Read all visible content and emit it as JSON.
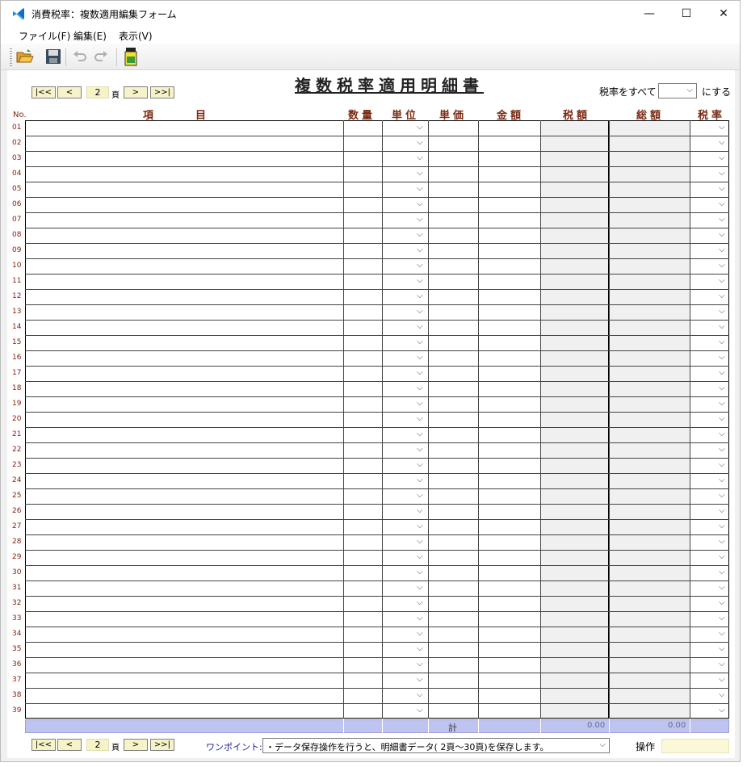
{
  "window": {
    "title": "消費税率：複数適用編集フォーム"
  },
  "menu": {
    "file": "ファイル(F)",
    "edit": "編集(E)",
    "view": "表示(V)"
  },
  "nav": {
    "first": "|<<",
    "prev": "<",
    "page": "2",
    "page_unit": "頁",
    "next": ">",
    "last": ">>|"
  },
  "doc_title": "複数税率適用明細書",
  "tax_all": {
    "label": "税率をすべて",
    "suffix": "にする"
  },
  "columns": {
    "no": "No.",
    "item": "項　　　　目",
    "qty": "数量",
    "unit": "単位",
    "price": "単価",
    "amount": "金額",
    "tax": "税額",
    "total": "総額",
    "rate": "税率"
  },
  "rows": [
    "01",
    "02",
    "03",
    "04",
    "05",
    "06",
    "07",
    "08",
    "09",
    "10",
    "11",
    "12",
    "13",
    "14",
    "15",
    "16",
    "17",
    "18",
    "19",
    "20",
    "21",
    "22",
    "23",
    "24",
    "25",
    "26",
    "27",
    "28",
    "29",
    "30",
    "31",
    "32",
    "33",
    "34",
    "35",
    "36",
    "37",
    "38",
    "39"
  ],
  "totals": {
    "label": "計",
    "tax": "0.00",
    "total": "0.00"
  },
  "footer": {
    "hint_label": "ワンポイント:",
    "hint_text": "・データ保存操作を行うと、明細書データ( 2頁～30頁)を保存します。",
    "op_label": "操作"
  },
  "colors": {
    "header_text": "#7b2a12",
    "nav_bg": "#f7f3c8",
    "total_bar": "#bfc3f0"
  }
}
